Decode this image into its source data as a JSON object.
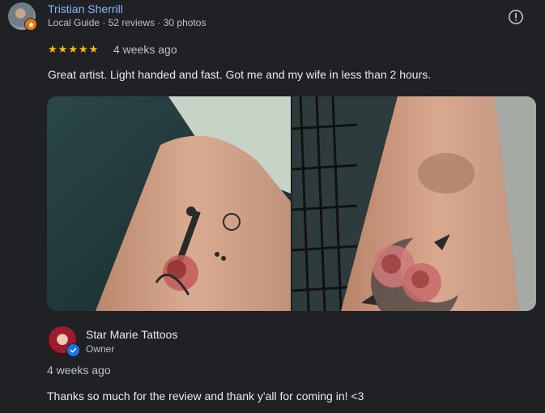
{
  "review": {
    "reviewer_name": "Tristian Sherrill",
    "reviewer_meta": "Local Guide · 52 reviews · 30 photos",
    "rating": 5,
    "stars": [
      "★",
      "★",
      "★",
      "★",
      "★"
    ],
    "date": "4 weeks ago",
    "text": "Great artist. Light handed and fast. Got me and my wife in less than 2 hours.",
    "photos_count_shown": 2
  },
  "owner_reply": {
    "name": "Star Marie Tattoos",
    "role": "Owner",
    "date": "4 weeks ago",
    "text": "Thanks so much for the review and thank y'all for coming in! <3"
  },
  "icons": {
    "flag": "report-flag-icon",
    "local_guide_badge": "local-guide-star-icon",
    "verified": "verified-check-icon"
  },
  "colors": {
    "background": "#202124",
    "link": "#8ab4f8",
    "star": "#fbbc04",
    "verified": "#1a73e8",
    "local_guide": "#e8710a"
  }
}
